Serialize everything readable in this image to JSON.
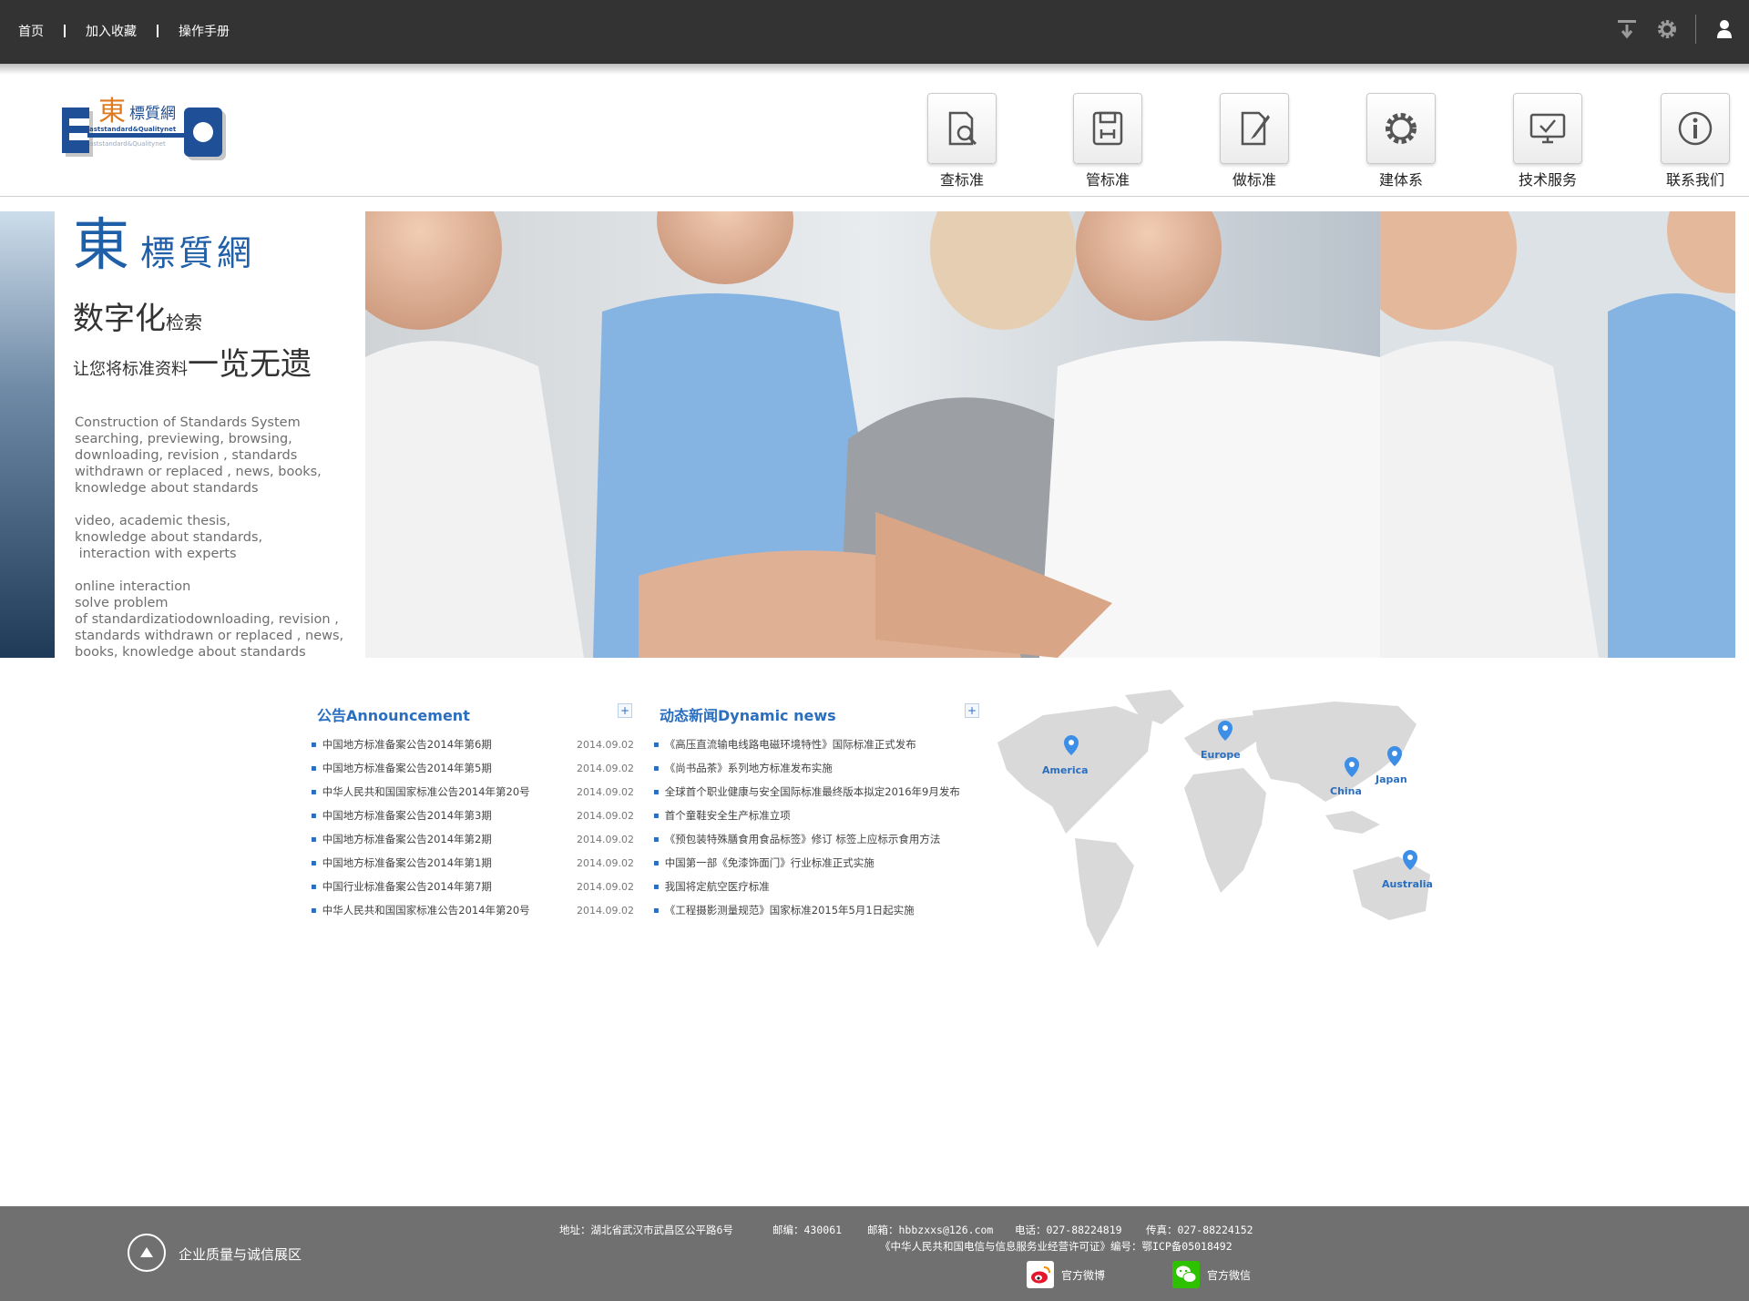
{
  "topnav": {
    "home": "首页",
    "favorite": "加入收藏",
    "manual": "操作手册"
  },
  "logo": {
    "char": "東",
    "name": "標質網",
    "en1": "aststandard&Qualitynet",
    "en2": "aststandard&Qualitynet"
  },
  "nav": [
    {
      "label": "查标准",
      "icon": "search-document-icon"
    },
    {
      "label": "管标准",
      "icon": "save-disk-icon"
    },
    {
      "label": "做标准",
      "icon": "edit-document-icon"
    },
    {
      "label": "建体系",
      "icon": "gear-icon"
    },
    {
      "label": "技术服务",
      "icon": "monitor-check-icon"
    },
    {
      "label": "联系我们",
      "icon": "info-icon"
    }
  ],
  "banner": {
    "brand_big": "東",
    "brand_small": "標質網",
    "tag1_big": "数字化",
    "tag1_small": "检索",
    "tag2_small": "让您将标准资料",
    "tag2_big": "一览无遗",
    "desc1": "Construction of Standards System\nsearching, previewing, browsing,\ndownloading, revision , standards\nwithdrawn or replaced , news, books,\nknowledge about standards",
    "desc2": "video, academic thesis,\nknowledge about standards,\n interaction with experts",
    "desc3": "online interaction\nsolve problem\nof standardizatiodownloading, revision ,\nstandards withdrawn or replaced , news,\nbooks, knowledge about standards"
  },
  "announcement": {
    "title": "公告Announcement",
    "more": "+",
    "items": [
      {
        "text": "中国地方标准备案公告2014年第6期",
        "date": "2014.09.02"
      },
      {
        "text": "中国地方标准备案公告2014年第5期",
        "date": "2014.09.02"
      },
      {
        "text": "中华人民共和国国家标准公告2014年第20号",
        "date": "2014.09.02"
      },
      {
        "text": "中国地方标准备案公告2014年第3期",
        "date": "2014.09.02"
      },
      {
        "text": "中国地方标准备案公告2014年第2期",
        "date": "2014.09.02"
      },
      {
        "text": "中国地方标准备案公告2014年第1期",
        "date": "2014.09.02"
      },
      {
        "text": "中国行业标准备案公告2014年第7期",
        "date": "2014.09.02"
      },
      {
        "text": "中华人民共和国国家标准公告2014年第20号",
        "date": "2014.09.02"
      }
    ]
  },
  "news": {
    "title": "动态新闻Dynamic news",
    "more": "+",
    "items": [
      {
        "text": "《高压直流输电线路电磁环境特性》国际标准正式发布"
      },
      {
        "text": "《尚书品茶》系列地方标准发布实施"
      },
      {
        "text": "全球首个职业健康与安全国际标准最终版本拟定2016年9月发布"
      },
      {
        "text": "首个童鞋安全生产标准立项"
      },
      {
        "text": "《预包装特殊膳食用食品标签》修订 标签上应标示食用方法"
      },
      {
        "text": "中国第一部《免漆饰面门》行业标准正式实施"
      },
      {
        "text": "我国将定航空医疗标准"
      },
      {
        "text": "《工程摄影测量规范》国家标准2015年5月1日起实施"
      }
    ]
  },
  "map": {
    "labels": [
      "America",
      "Europe",
      "China",
      "Japan",
      "Australia"
    ],
    "pin_color": "#3d8ee6"
  },
  "footer": {
    "left_label": "企业质量与诚信展区",
    "address": "地址：湖北省武汉市武昌区公平路6号",
    "postcode": "邮编：430061",
    "email": "邮箱：hbbzxxs@126.com",
    "phone": "电话：027-88224819",
    "fax": "传真：027-88224152",
    "license": "《中华人民共和国电信与信息服务业经营许可证》编号：鄂ICP备05018492",
    "weibo": "官方微博",
    "wechat": "官方微信"
  },
  "colors": {
    "topbar": "#333333",
    "accent": "#2a6ec0",
    "footer": "#707070"
  }
}
